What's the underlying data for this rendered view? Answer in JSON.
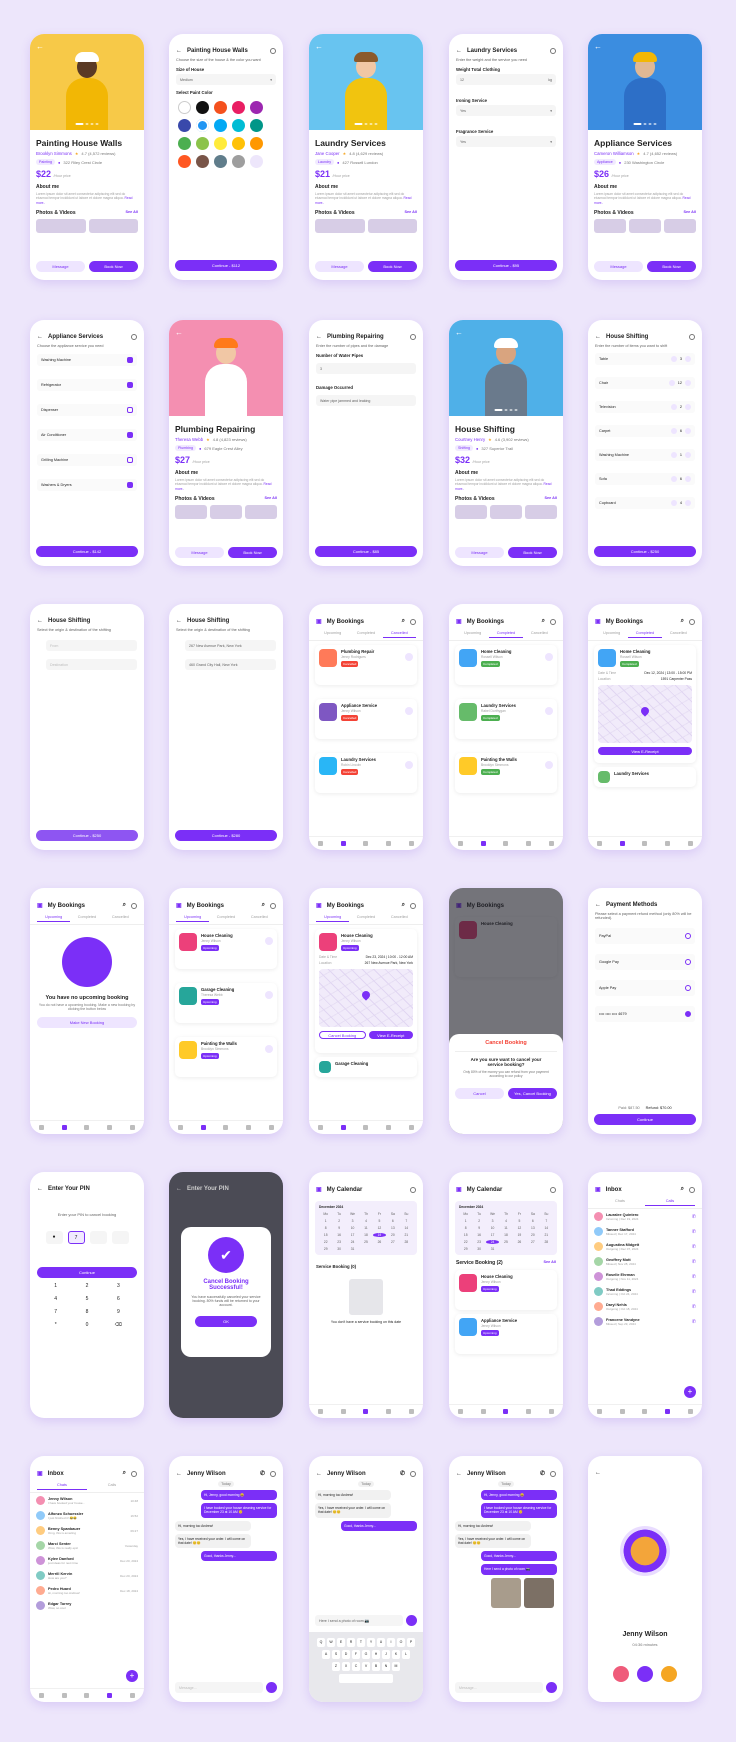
{
  "colors": {
    "accent": "#7b2ff7",
    "bg": "#ede6fb"
  },
  "hero": [
    {
      "title": "Painting House Walls",
      "provider": "Brooklyn Simmons",
      "rating": "4.7 (4,572 reviews)",
      "tag": "Painting",
      "address": "322 Riley Crest Circle",
      "price": "$22",
      "price_note": "/Hour price",
      "photo": "#f7c948",
      "shirt": "#f2b705",
      "skin": "#5a3a25",
      "hat": "#fff"
    },
    {
      "title": "Laundry Services",
      "provider": "Jane Cooper",
      "rating": "4.8 (4,629 reviews)",
      "tag": "Laundry",
      "address": "427 Rossell Lundon",
      "price": "$21",
      "price_note": "/Hour price",
      "photo": "#68c4f0",
      "shirt": "#f1c40f",
      "skin": "#f1c7a5",
      "hat": "#8b5a2b"
    },
    {
      "title": "Appliance Services",
      "provider": "Cameron Williamson",
      "rating": "4.7 (4,652 reviews)",
      "tag": "Appliance",
      "address": "230 Washington Circle",
      "price": "$26",
      "price_note": "/Hour price",
      "photo": "#3b8de0",
      "shirt": "#2d6fc7",
      "skin": "#e0b894",
      "hat": "#f2b705"
    },
    {
      "title": "Plumbing Repairing",
      "provider": "Theresa Webb",
      "rating": "4.8 (4,823 reviews)",
      "tag": "Plumbing",
      "address": "679 Eagle Crest Alley",
      "price": "$27",
      "price_note": "/Hour price",
      "photo": "#f48fb1",
      "shirt": "#ffffff",
      "skin": "#f1c7a5",
      "hat": "#ff7a1a"
    },
    {
      "title": "House Shifting",
      "provider": "Courtney Henry",
      "rating": "4.6 (3,902 reviews)",
      "tag": "Shifting",
      "address": "327 Superior Trail",
      "price": "$32",
      "price_note": "/Hour price",
      "photo": "#4fb0e8",
      "shirt": "#6a7a8c",
      "skin": "#d9a47f",
      "hat": "#ffffff"
    }
  ],
  "common": {
    "about": "About me",
    "photos": "Photos & Videos",
    "see_all": "See All",
    "message": "Message",
    "book_now": "Book Now",
    "read_more": "Read more..",
    "lorem": "Lorem ipsum dolor sit amet consectetur adipiscing elit sed do eiusmod tempor incididunt ut labore et dolore magna aliqua."
  },
  "painting": {
    "title": "Painting House Walls",
    "sub": "Choose the size of the house & the color you want",
    "size_label": "Size of House",
    "size_value": "Medium",
    "color_label": "Select Paint Color",
    "cta": "Continue - $112",
    "colors": [
      "#ffffff",
      "#111111",
      "#f4511e",
      "#e91e63",
      "#9c27b0",
      "#3949ab",
      "#2196f3",
      "#03a9f4",
      "#00bcd4",
      "#009688",
      "#4caf50",
      "#8bc34a",
      "#ffeb3b",
      "#ffc107",
      "#ff9800",
      "#ff5722",
      "#795548",
      "#607d8b",
      "#9e9e9e",
      "#ede6fb"
    ]
  },
  "laundry": {
    "title": "Laundry Services",
    "sub": "Enter the weight and the service you need",
    "weight_label": "Weight Total Clothing",
    "weight_value": "12",
    "weight_unit": "kg",
    "ironing_label": "Ironing Service",
    "ironing_value": "Yes",
    "fragrance_label": "Fragrance Service",
    "fragrance_value": "Yes",
    "cta": "Continue - $95"
  },
  "appliance": {
    "title": "Appliance Services",
    "sub": "Choose the appliance service you need",
    "items": [
      {
        "name": "Washing Machine",
        "on": true
      },
      {
        "name": "Refrigerator",
        "on": true
      },
      {
        "name": "Dispenser",
        "on": false
      },
      {
        "name": "Air Conditioner",
        "on": true
      },
      {
        "name": "Grilling Machine",
        "on": false
      },
      {
        "name": "Washers & Dryers",
        "on": true
      }
    ],
    "cta": "Continue - $142"
  },
  "plumbing": {
    "title": "Plumbing Repairing",
    "sub": "Enter the number of pipes and the damage",
    "pipes_label": "Number of Water Pipes",
    "pipes_value": "3",
    "damage_label": "Damage Occurred",
    "damage_value": "Water pipe jammed and leaking",
    "cta": "Continue - $85"
  },
  "shifting": {
    "title": "House Shifting",
    "sub": "Enter the number of items you want to shift",
    "items": [
      {
        "name": "Table",
        "qty": "3"
      },
      {
        "name": "Chair",
        "qty": "12"
      },
      {
        "name": "Television",
        "qty": "2"
      },
      {
        "name": "Carpet",
        "qty": "6"
      },
      {
        "name": "Washing Machine",
        "qty": "1"
      },
      {
        "name": "Sofa",
        "qty": "6"
      },
      {
        "name": "Cupboard",
        "qty": "4"
      }
    ],
    "cta": "Continue - $250"
  },
  "shift_dest": {
    "title": "House Shifting",
    "sub": "Select the origin & destination of the shifting",
    "from_ph": "From",
    "to_ph": "Destination",
    "from": "267 New Avenue Park, New York",
    "to": "460 Grand City Hall, New York",
    "cta": "Continue - $280"
  },
  "bookings": {
    "title": "My Bookings",
    "tabs": [
      "Upcoming",
      "Completed",
      "Cancelled"
    ],
    "cancelled": [
      {
        "name": "Plumbing Repair",
        "by": "Jenny Rodrigues",
        "status": "Cancelled",
        "c": "#ff7a59"
      },
      {
        "name": "Appliance Service",
        "by": "Jenny Wilson",
        "status": "Cancelled",
        "c": "#7e57c2"
      },
      {
        "name": "Laundry Services",
        "by": "Robin Lincoln",
        "status": "Cancelled",
        "c": "#29b6f6"
      }
    ],
    "completed": [
      {
        "name": "Home Cleaning",
        "by": "Rossell Wilson",
        "status": "Completed",
        "c": "#42a5f5"
      },
      {
        "name": "Laundry Services",
        "by": "Rabel Dorthygan",
        "status": "Completed",
        "c": "#66bb6a"
      },
      {
        "name": "Painting the Walls",
        "by": "Brooklyn Simmons",
        "status": "Completed",
        "c": "#ffca28"
      }
    ],
    "upcoming": [
      {
        "name": "House Cleaning",
        "by": "Jenny Wilson",
        "status": "Upcoming",
        "c": "#ec407a"
      },
      {
        "name": "Garage Cleaning",
        "by": "Theresa Webb",
        "status": "Upcoming",
        "c": "#26a69a"
      },
      {
        "name": "Painting the Walls",
        "by": "Brooklyn Simmons",
        "status": "Upcoming",
        "c": "#ffca28"
      }
    ],
    "date_label": "Date & Time",
    "date_value": "Dec 12, 2024 | 13:00 - 15:00 PM",
    "loc_label": "Location",
    "loc_value": "1591 Carpenter Pass",
    "date_value2": "Dec 23, 2024 | 10:00 - 12:00 AM",
    "loc_value2": "267 New Avenue Park, New York",
    "view_receipt": "View E-Receipt",
    "cancel_booking": "Cancel Booking",
    "empty_title": "You have no upcoming booking",
    "empty_sub": "You do not have a upcoming booking. Make a new booking by clicking the button below",
    "make_booking": "Make New Booking",
    "last_laundry": "Laundry Services",
    "last_garage": "Garage Cleaning"
  },
  "cancel_sheet": {
    "title": "Cancel Booking",
    "q": "Are you sure want to cancel your service booking?",
    "note": "Only 80% of the money you can refund from your payment according to our policy",
    "no": "Cancel",
    "yes": "Yes, Cancel Booking"
  },
  "payment": {
    "title": "Payment Methods",
    "sub": "Please select a payment refund method (only 80% will be refunded).",
    "methods": [
      "PayPal",
      "Google Pay",
      "Apple Pay",
      "•••• •••• •••• 4679"
    ],
    "paid": "Paid: $87.50",
    "refund": "Refund: $70.00",
    "cta": "Continue"
  },
  "pin": {
    "title": "Enter Your PIN",
    "sub": "Enter your PIN to cancel booking",
    "digit": "7",
    "cta": "Continue",
    "keys": [
      "1",
      "2",
      "3",
      "4",
      "5",
      "6",
      "7",
      "8",
      "9",
      "*",
      "0",
      "⌫"
    ]
  },
  "success": {
    "title": "Cancel Booking Successful!",
    "text": "You have successfully canceled your service booking. 80% funds will be returned to your account.",
    "ok": "OK"
  },
  "calendar": {
    "title": "My Calendar",
    "month": "December 2024",
    "days": [
      "Mo",
      "Tu",
      "We",
      "Th",
      "Fr",
      "Sa",
      "Su"
    ],
    "empty_head": "Service Booking (0)",
    "empty_text": "You don't have a service booking on this date",
    "head2": "Service Booking (2)",
    "items": [
      {
        "name": "House Cleaning",
        "by": "Jenny Wilson",
        "c": "#ec407a"
      },
      {
        "name": "Appliance Service",
        "by": "Jenny Wilson",
        "c": "#42a5f5"
      }
    ]
  },
  "inbox": {
    "title": "Inbox",
    "tabs": [
      "Chats",
      "Calls"
    ],
    "calls": [
      {
        "n": "Lauralee Quintero",
        "s": "Incoming | Dec 19, 2024"
      },
      {
        "n": "Tanner Stafford",
        "s": "Missed | Dec 17, 2024"
      },
      {
        "n": "Augustina Midgett",
        "s": "Outgoing | Dec 07, 2024"
      },
      {
        "n": "Geoffrey Mott",
        "s": "Missed | Nov 28, 2024"
      },
      {
        "n": "Roselle Ehrman",
        "s": "Outgoing | Nov 11, 2024"
      },
      {
        "n": "Thad Eddings",
        "s": "Incoming | Oct 24, 2024"
      },
      {
        "n": "Daryl Nehls",
        "s": "Outgoing | Oct 18, 2024"
      },
      {
        "n": "Francene Vandyne",
        "s": "Missed | Sep 29, 2024"
      }
    ],
    "chats": [
      {
        "n": "Jenny Wilson",
        "s": "I have booked your house...",
        "t": "10:48"
      },
      {
        "n": "Alfonzo Schuessler",
        "s": "I just finished it! 😂😂",
        "t": "16:52"
      },
      {
        "n": "Benny Spanbauer",
        "s": "Omg, this is amazing",
        "t": "09:27"
      },
      {
        "n": "Marci Senter",
        "s": "Wow, this is really epic",
        "t": "Yesterday"
      },
      {
        "n": "Kylee Danford",
        "s": "just ideas for next time",
        "t": "Dec 20, 2024"
      },
      {
        "n": "Merrill Kervin",
        "s": "How are you?",
        "t": "Dec 20, 2024"
      },
      {
        "n": "Pedro Huard",
        "s": "Hi, morning too Andrew!",
        "t": "Dec 18, 2024"
      },
      {
        "n": "Edgar Torrey",
        "s": "Wow, so cool",
        "t": ""
      }
    ],
    "msg_ph": "Message..."
  },
  "chat": {
    "name": "Jenny Wilson",
    "today": "Today",
    "m1": "Hi, Jenny, good morning 😄",
    "m2": "I have booked your house cleaning service for December 23 at 10 AM 😊",
    "m3": "Hi, morning too Andrew!",
    "m4": "Yes, I have received your order. I will come on that date! 😊😊",
    "m5": "Good, thanks Jenny...",
    "m6": "Here I send a photo of room 📷",
    "m7": "Here I send a photo of room 📷",
    "kb": [
      "Q",
      "W",
      "E",
      "R",
      "T",
      "Y",
      "U",
      "I",
      "O",
      "P"
    ],
    "kb2": [
      "A",
      "S",
      "D",
      "F",
      "G",
      "H",
      "J",
      "K",
      "L"
    ],
    "kb3": [
      "Z",
      "X",
      "C",
      "V",
      "B",
      "N",
      "M"
    ]
  },
  "call": {
    "name": "Jenny Wilson",
    "time": "04:36 minutes"
  }
}
